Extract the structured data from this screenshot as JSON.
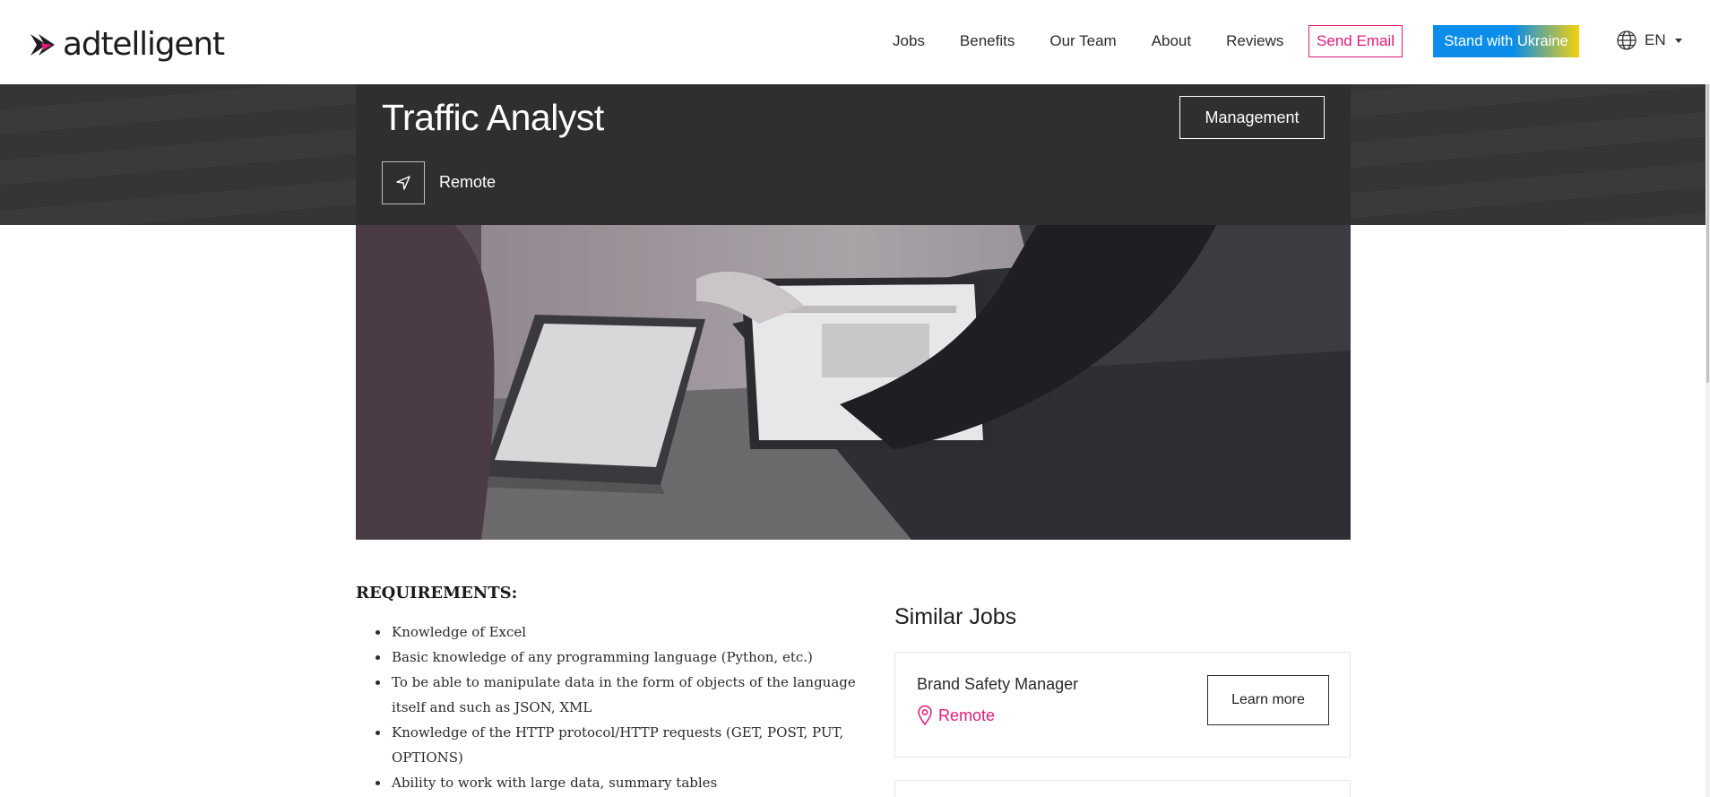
{
  "brand": {
    "name": "adtelligent",
    "accent": "#e2197c"
  },
  "nav": {
    "items": [
      "Jobs",
      "Benefits",
      "Our Team",
      "About",
      "Reviews"
    ],
    "send_email": "Send Email",
    "ukraine": "Stand with Ukraine",
    "language": "EN"
  },
  "job": {
    "title": "Traffic Analyst",
    "department": "Management",
    "location": "Remote"
  },
  "requirements": {
    "title": "REQUIREMENTS:",
    "items": [
      "Knowledge of Excel",
      "Basic knowledge of any programming language (Python, etc.)",
      "To be able to manipulate data in the form of objects of the language itself and such as JSON, XML",
      "Knowledge of the HTTP protocol/HTTP requests (GET, POST, PUT, OPTIONS)",
      "Ability to work with large data, summary tables"
    ]
  },
  "similar": {
    "title": "Similar Jobs",
    "jobs": [
      {
        "title": "Brand Safety Manager",
        "location": "Remote",
        "cta": "Learn more"
      }
    ]
  },
  "icons": [
    "logo-mark-icon",
    "globe-icon",
    "caret-down-icon",
    "navigation-arrow-icon",
    "map-pin-icon"
  ]
}
